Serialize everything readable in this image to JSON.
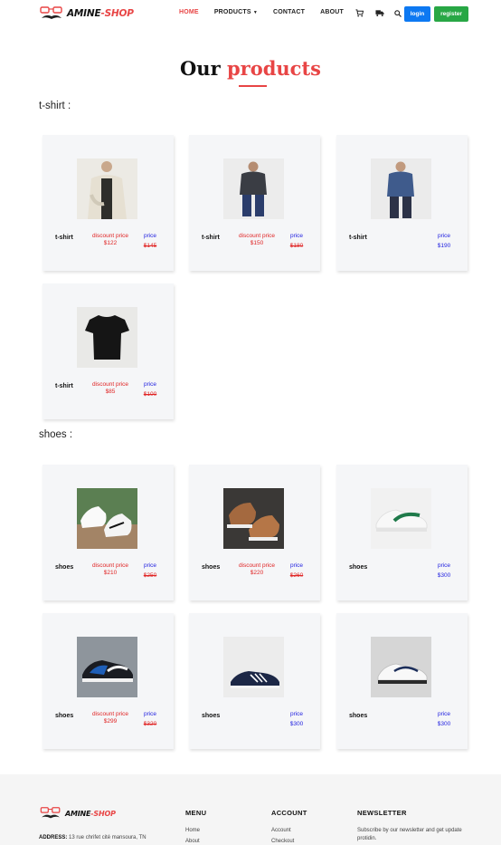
{
  "nav": {
    "brand_main": "AMINE",
    "brand_accent": "-SHOP",
    "links": [
      "HOME",
      "PRODUCTS",
      "CONTACT",
      "ABOUT"
    ],
    "login": "login",
    "register": "register"
  },
  "title": {
    "main": "Our ",
    "accent": "products"
  },
  "sections": {
    "tshirt": "t-shirt :",
    "shoes": "shoes :"
  },
  "products": [
    {
      "name": "t-shirt",
      "discount_label": "discount price",
      "discount": "$122",
      "price_label": "price",
      "price": "$145"
    },
    {
      "name": "t-shirt",
      "discount_label": "discount price",
      "discount": "$150",
      "price_label": "price",
      "price": "$180"
    },
    {
      "name": "t-shirt",
      "price_label": "price",
      "price": "$190"
    },
    {
      "name": "t-shirt",
      "discount_label": "discount price",
      "discount": "$85",
      "price_label": "price",
      "price": "$100"
    },
    {
      "name": "shoes",
      "discount_label": "discount price",
      "discount": "$210",
      "price_label": "price",
      "price": "$250"
    },
    {
      "name": "shoes",
      "discount_label": "discount price",
      "discount": "$220",
      "price_label": "price",
      "price": "$260"
    },
    {
      "name": "shoes",
      "price_label": "price",
      "price": "$300"
    },
    {
      "name": "shoes",
      "discount_label": "discount price",
      "discount": "$299",
      "price_label": "price",
      "price": "$320"
    },
    {
      "name": "shoes",
      "price_label": "price",
      "price": "$300"
    },
    {
      "name": "shoes",
      "price_label": "price",
      "price": "$300"
    }
  ],
  "footer": {
    "brand_main": "AMINE",
    "brand_accent": "-SHOP",
    "address_label": "ADDRESS:",
    "address": " 13 rue chrifet cité mansoura, TN",
    "menu_title": "MENU",
    "menu_links": [
      "Home",
      "About"
    ],
    "account_title": "ACCOUNT",
    "account_links": [
      "Account",
      "Checkout"
    ],
    "newsletter_title": "NEWSLETTER",
    "newsletter_text": "Subscribe by our newsletter and get update protidin."
  },
  "colors": {
    "accent": "#e84545",
    "login": "#0d79f2",
    "register": "#28a745",
    "discount": "#e02424",
    "price": "#1e1ee0"
  }
}
